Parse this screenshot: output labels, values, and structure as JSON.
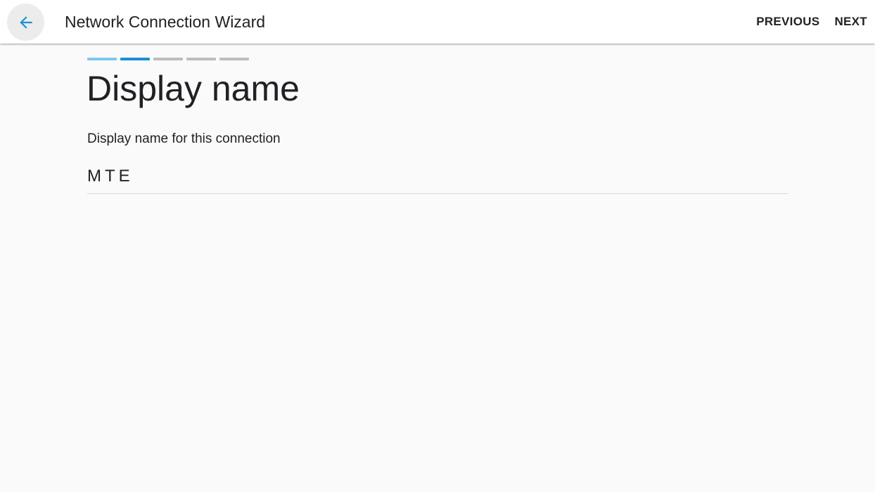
{
  "header": {
    "back_icon": "arrow-left-icon",
    "title": "Network Connection Wizard",
    "previous_label": "PREVIOUS",
    "next_label": "NEXT"
  },
  "stepper": {
    "total_steps": 5,
    "current_step": 2,
    "colors": {
      "done": "#7cc9ec",
      "current": "#1a8fd6",
      "pending": "#bdbdbd"
    }
  },
  "main": {
    "title": "Display name",
    "field": {
      "label": "Display name for this connection",
      "value": "MTE"
    }
  },
  "colors": {
    "accent": "#1a8fd6",
    "app_bar": "#ffffff",
    "background": "#fafafa"
  }
}
